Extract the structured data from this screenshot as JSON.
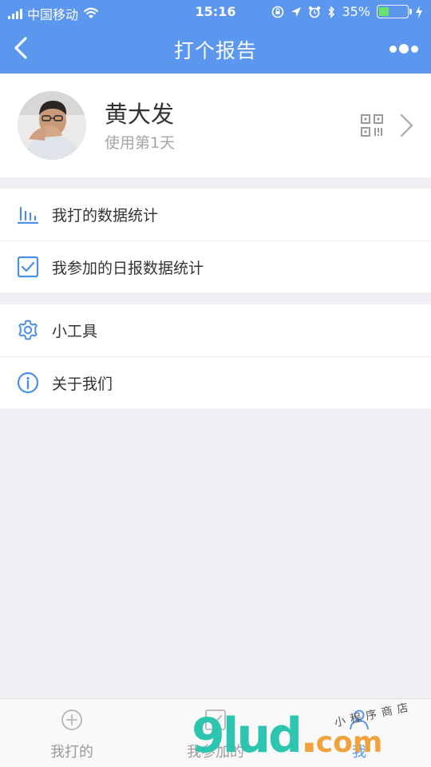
{
  "status_bar": {
    "carrier": "中国移动",
    "time": "15:16",
    "battery_percent": "35%",
    "battery_level": 0.35,
    "icons": [
      "signal-icon",
      "wifi-icon",
      "rotation-lock-icon",
      "location-icon",
      "alarm-icon",
      "bluetooth-icon",
      "battery-icon",
      "charging-icon"
    ]
  },
  "nav": {
    "title": "打个报告",
    "back_icon": "chevron-left-icon",
    "more_icon": "more-dots-icon"
  },
  "profile": {
    "name": "黄大发",
    "days_text": "使用第1天",
    "qr_icon": "qr-code-icon",
    "chevron_icon": "chevron-right-icon"
  },
  "menu_groups": [
    {
      "items": [
        {
          "label": "我打的数据统计",
          "icon": "bar-chart-icon"
        },
        {
          "label": "我参加的日报数据统计",
          "icon": "checkbox-icon"
        }
      ]
    },
    {
      "items": [
        {
          "label": "小工具",
          "icon": "gear-icon"
        },
        {
          "label": "关于我们",
          "icon": "info-icon"
        }
      ]
    }
  ],
  "tabbar": {
    "tabs": [
      {
        "label": "我打的",
        "icon": "plus-circle-icon",
        "active": false
      },
      {
        "label": "我参加的",
        "icon": "checkbox-icon",
        "active": false
      },
      {
        "label": "我",
        "icon": "person-icon",
        "active": true
      }
    ]
  },
  "watermark": {
    "main": "9lud",
    "dot": ".",
    "suffix": "com",
    "script": "小程序商店"
  },
  "colors": {
    "brand_blue": "#5b97ef",
    "icon_blue": "#4a8fe7",
    "background": "#efeff4",
    "battery_green": "#65e36b"
  }
}
